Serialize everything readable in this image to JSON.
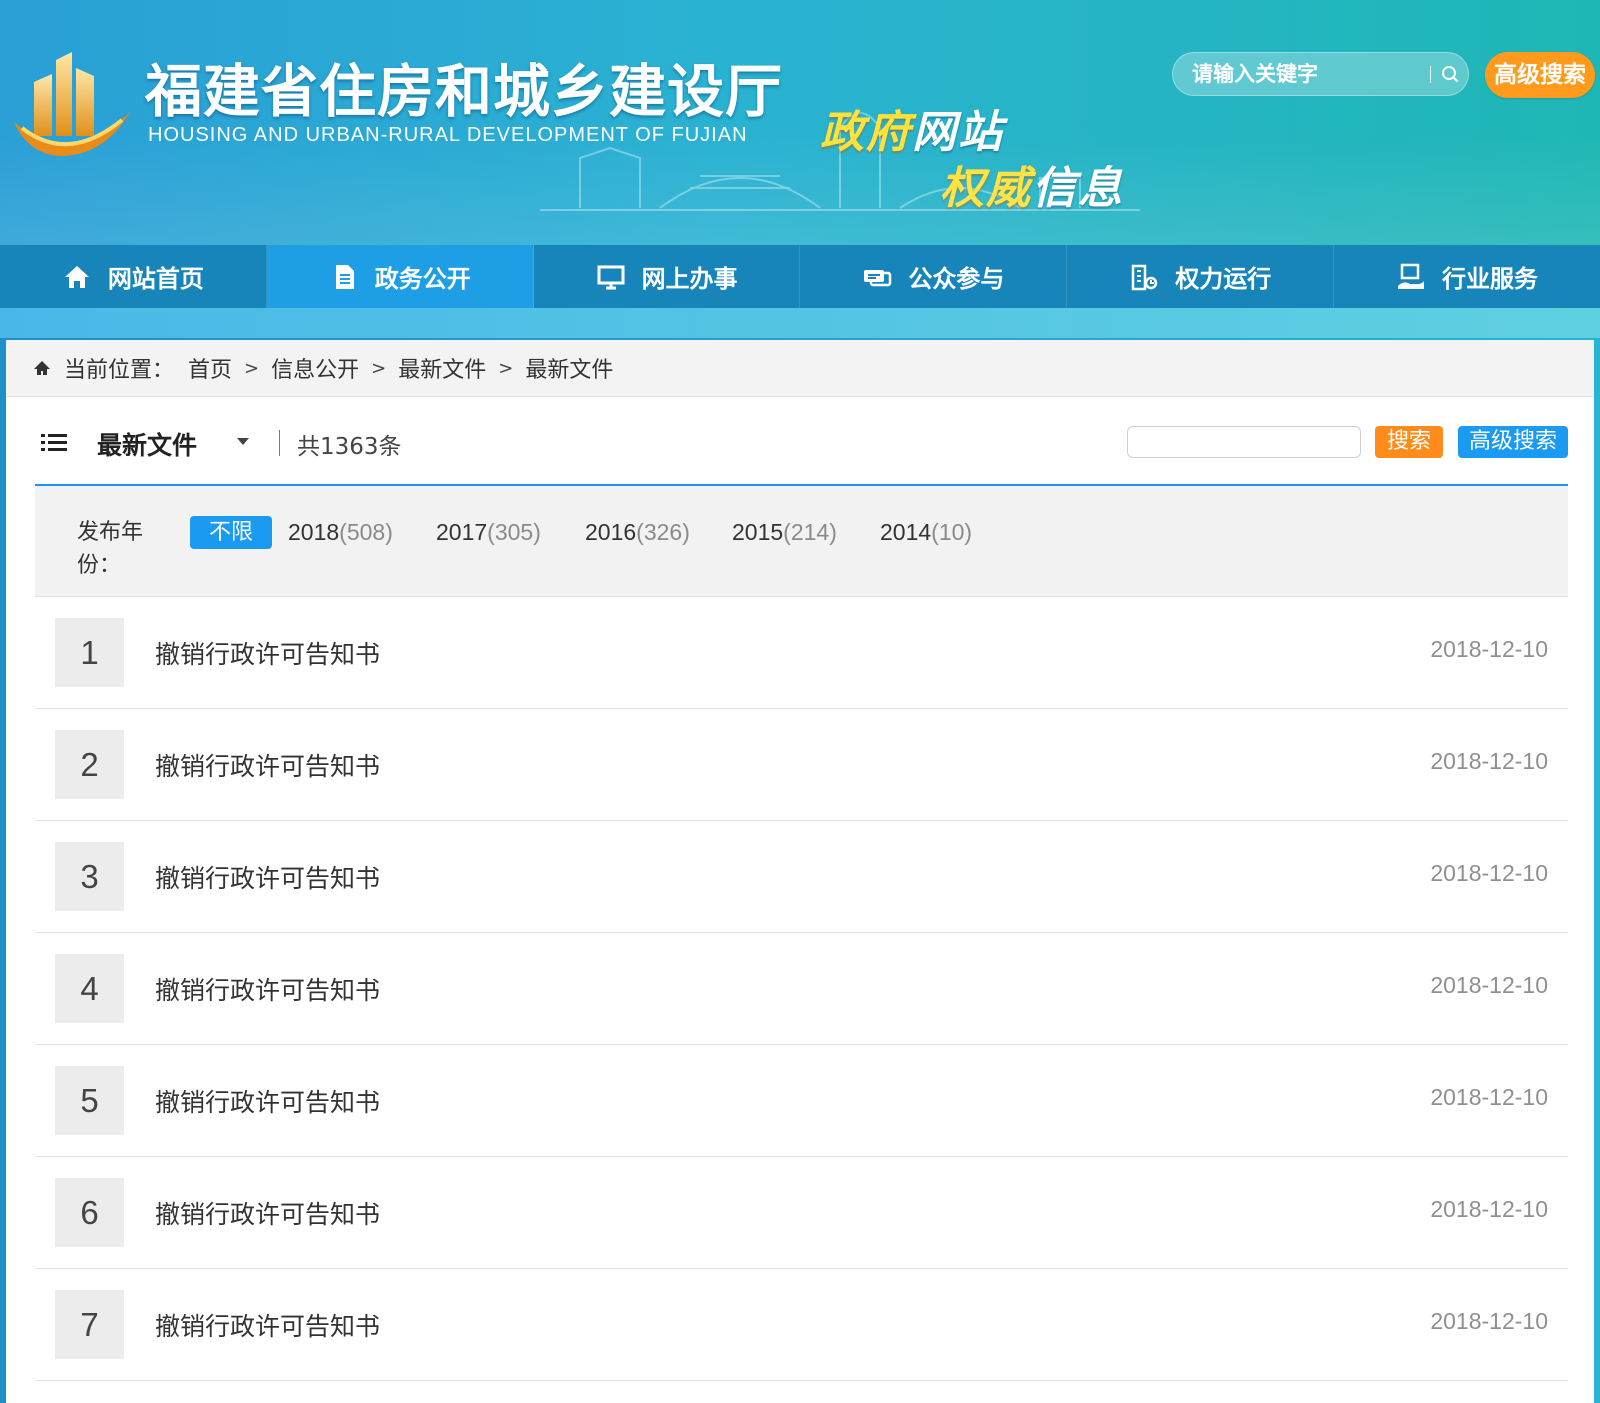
{
  "header": {
    "title": "福建省住房和城乡建设厅",
    "subtitle": "HOUSING AND URBAN-RURAL DEVELOPMENT OF FUJIAN",
    "slogan_line1_a": "政府",
    "slogan_line1_b": "网站",
    "slogan_line2_a": "权威",
    "slogan_line2_b": "信息",
    "search_placeholder": "请输入关键字",
    "advanced_search_label": "高级搜索"
  },
  "nav": {
    "items": [
      {
        "label": "网站首页",
        "icon": "home-icon"
      },
      {
        "label": "政务公开",
        "icon": "document-icon",
        "active": true
      },
      {
        "label": "网上办事",
        "icon": "monitor-icon"
      },
      {
        "label": "公众参与",
        "icon": "chat-icon"
      },
      {
        "label": "权力运行",
        "icon": "building-icon"
      },
      {
        "label": "行业服务",
        "icon": "service-icon"
      }
    ]
  },
  "breadcrumb": {
    "prefix": "当前位置：",
    "items": [
      "首页",
      "信息公开",
      "最新文件",
      "最新文件"
    ],
    "separator": ">"
  },
  "list_header": {
    "title": "最新文件",
    "count": "共1363条",
    "search_label": "搜索",
    "advanced_search_label": "高级搜索"
  },
  "year_filter": {
    "label": "发布年份：",
    "options": [
      {
        "label": "不限",
        "count": "",
        "active": true
      },
      {
        "label": "2018",
        "count": "(508)"
      },
      {
        "label": "2017",
        "count": "(305)"
      },
      {
        "label": "2016",
        "count": "(326)"
      },
      {
        "label": "2015",
        "count": "(214)"
      },
      {
        "label": "2014",
        "count": "(10)"
      }
    ]
  },
  "documents": [
    {
      "num": "1",
      "title": "撤销行政许可告知书",
      "date": "2018-12-10"
    },
    {
      "num": "2",
      "title": "撤销行政许可告知书",
      "date": "2018-12-10"
    },
    {
      "num": "3",
      "title": "撤销行政许可告知书",
      "date": "2018-12-10"
    },
    {
      "num": "4",
      "title": "撤销行政许可告知书",
      "date": "2018-12-10"
    },
    {
      "num": "5",
      "title": "撤销行政许可告知书",
      "date": "2018-12-10"
    },
    {
      "num": "6",
      "title": "撤销行政许可告知书",
      "date": "2018-12-10"
    },
    {
      "num": "7",
      "title": "撤销行政许可告知书",
      "date": "2018-12-10"
    }
  ],
  "colors": {
    "nav_bg": "#1785b9",
    "nav_active": "#1e9ee4",
    "accent_orange": "#ff8c1a",
    "accent_blue": "#1a9af0",
    "slogan_yellow": "#ffe13c"
  }
}
